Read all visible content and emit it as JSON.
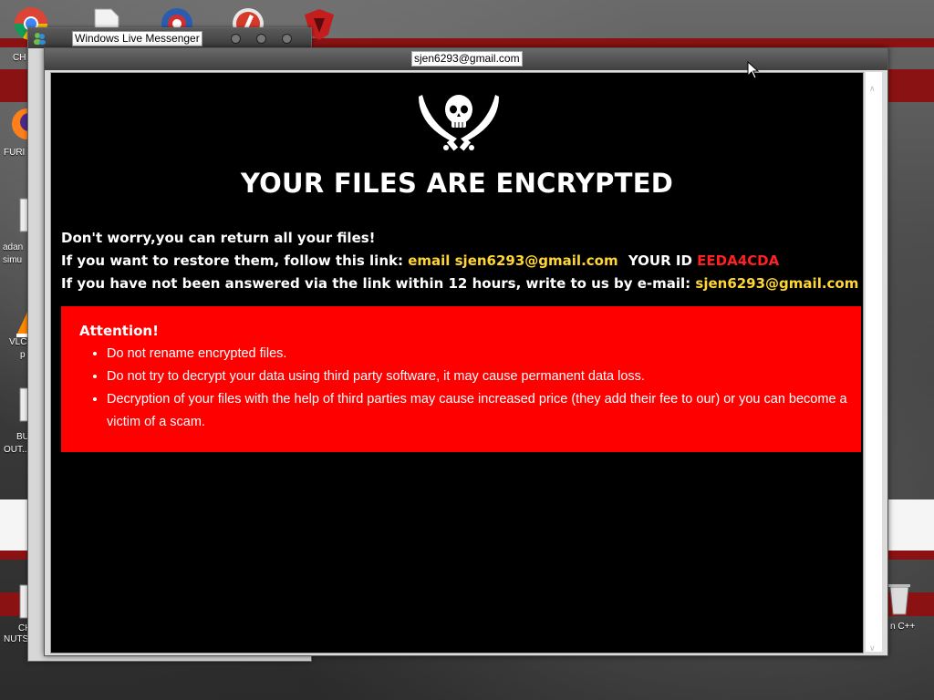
{
  "desktop": {
    "icons": [
      {
        "name": "chrome-icon",
        "label": "CH"
      },
      {
        "name": "document-icon",
        "label": ""
      },
      {
        "name": "app-icon-blue",
        "label": ""
      },
      {
        "name": "app-icon-red",
        "label": ""
      },
      {
        "name": "app-icon-shield",
        "label": ""
      },
      {
        "name": "firefox-icon",
        "label": "FURI"
      },
      {
        "name": "file-icon",
        "label": "adan"
      },
      {
        "name": "file-icon-2",
        "label": "simu"
      },
      {
        "name": "vlc-icon",
        "label": "VLC"
      },
      {
        "name": "vlc-icon-label2",
        "label": "p"
      },
      {
        "name": "file-icon-3",
        "label": "BU"
      },
      {
        "name": "file-icon-3-label2",
        "label": "OUT..."
      },
      {
        "name": "file-icon-4",
        "label": "CH"
      },
      {
        "name": "file-icon-4-label2",
        "label": "NUTS"
      },
      {
        "name": "recycle-bin-icon",
        "label": "n C++"
      }
    ]
  },
  "messenger": {
    "title": "Windows Live Messenger"
  },
  "note_window": {
    "title": "sjen6293@gmail.com"
  },
  "note": {
    "headline": "YOUR FILES ARE ENCRYPTED",
    "line1": "Don't worry,you can return all your files!",
    "line2_prefix": "If you want to restore them, follow this link: ",
    "line2_link": "email sjen6293@gmail.com",
    "line2_id_label": "YOUR ID ",
    "line2_id": "EEDA4CDA",
    "line3_prefix": "If you have not been answered via the link within 12 hours, write to us by e-mail: ",
    "line3_email": "sjen6293@gmail.com",
    "attention": {
      "title": "Attention!",
      "items": [
        "Do not rename encrypted files.",
        "Do not try to decrypt your data using third party software, it may cause permanent data loss.",
        "Decryption of your files with the help of third parties may cause increased price (they add their fee to our) or you can become a victim of a scam."
      ]
    }
  },
  "scrollbar": {
    "up": "∧",
    "down": "∨"
  },
  "colors": {
    "accent_yellow": "#ffd633",
    "accent_red": "#ff2020",
    "attention_bg": "#ff0000",
    "note_bg": "#000000",
    "desktop_stripe": "#8b1212"
  }
}
